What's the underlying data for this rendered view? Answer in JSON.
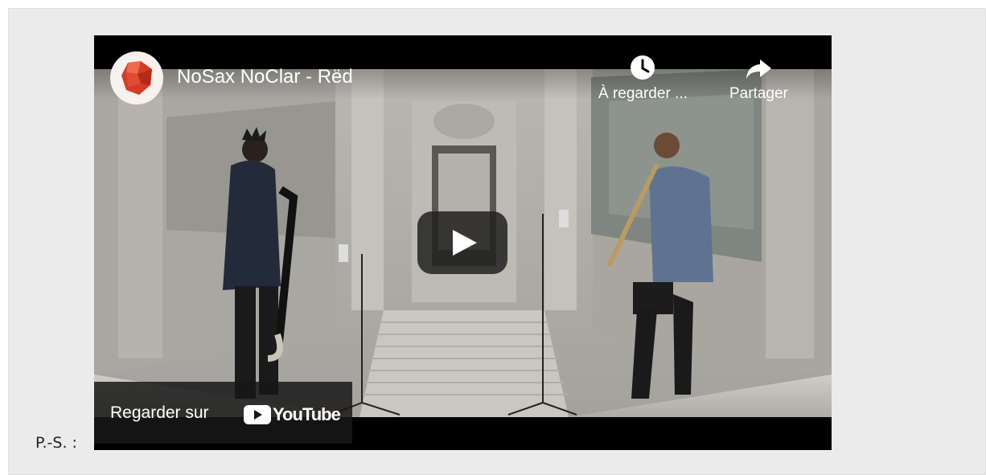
{
  "video": {
    "title": "NoSax NoClar - Rëd",
    "watch_later_label": "À regarder ...",
    "share_label": "Partager",
    "watch_on_label": "Regarder sur",
    "youtube_wordmark": "YouTube"
  },
  "icons": {
    "avatar": "red-crystal-avatar-icon",
    "watch_later": "clock-icon",
    "share": "share-arrow-icon",
    "play": "play-icon",
    "youtube": "youtube-logo-icon"
  },
  "colors": {
    "panel_bg": "#ebebeb",
    "youtube_red": "#ff0000",
    "player_bg": "#000000"
  },
  "footer": {
    "ps_label": "P.-S. :"
  }
}
